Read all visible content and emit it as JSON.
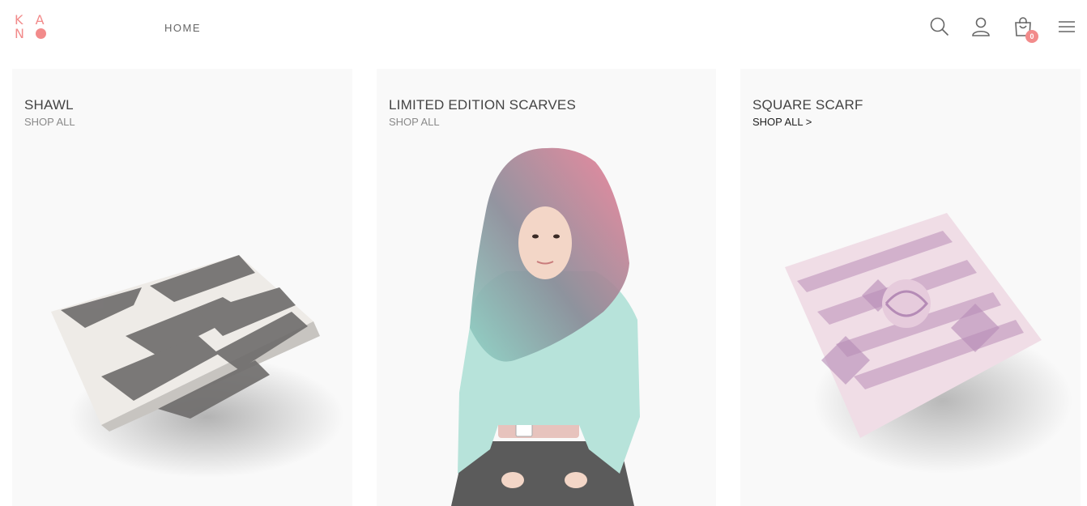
{
  "header": {
    "logo_line1": "K A",
    "logo_line2": "N",
    "nav_home": "HOME",
    "cart_count": "0",
    "icons": [
      "search-icon",
      "user-icon",
      "cart-icon",
      "menu-icon"
    ]
  },
  "cards": [
    {
      "title": "SHAWL",
      "link": "SHOP ALL"
    },
    {
      "title": "LIMITED EDITION SCARVES",
      "link": "SHOP ALL"
    },
    {
      "title": "SQUARE SCARF",
      "link": "SHOP ALL >"
    }
  ],
  "colors": {
    "accent": "#f28b8b",
    "card_bg": "#f9f9f9"
  }
}
